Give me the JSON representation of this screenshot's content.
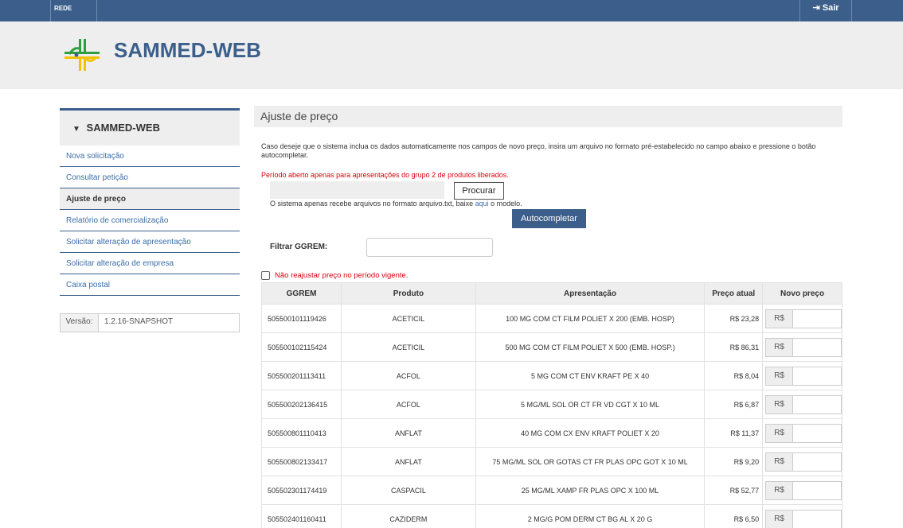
{
  "topbar": {
    "network_label": "REDE INTERNA",
    "logout_label": "Sair"
  },
  "header": {
    "app_title": "SAMMED-WEB"
  },
  "sidebar": {
    "title": "SAMMED-WEB",
    "items": [
      {
        "label": "Nova solicitação"
      },
      {
        "label": "Consultar petição"
      },
      {
        "label": "Ajuste de preço"
      },
      {
        "label": "Relatório de comercialização"
      },
      {
        "label": "Solicitar alteração de apresentação"
      },
      {
        "label": "Solicitar alteração de empresa"
      },
      {
        "label": "Caixa postal"
      }
    ],
    "version_label": "Versão:",
    "version_value": "1.2.16-SNAPSHOT"
  },
  "main": {
    "title": "Ajuste de preço",
    "info_text": "Caso deseje que o sistema inclua os dados automaticamente nos campos de novo preço, insira um arquivo no formato pré-estabelecido no campo abaixo e pressione o botão autocompletar.",
    "warning_text": "Período aberto apenas para apresentações do grupo 2 de produtos liberados.",
    "browse_label": "Procurar",
    "hint_before": "O sistema apenas recebe arquivos no formato arquivo.txt, baixe ",
    "hint_link": "aqui",
    "hint_after": " o modelo.",
    "autocomplete_label": "Autocompletar",
    "filter_label": "Filtrar GGREM:",
    "no_adjust_label": "Não reajustar preço no período vigente."
  },
  "table": {
    "headers": [
      "GGREM",
      "Produto",
      "Apresentação",
      "Preço atual",
      "Novo preço"
    ],
    "currency_prefix": "R$",
    "rows": [
      {
        "ggrem": "505500101119426",
        "produto": "ACETICIL",
        "apresentacao": "100 MG COM CT FILM POLIET X 200 (EMB. HOSP)",
        "preco": "R$ 23,28"
      },
      {
        "ggrem": "505500102115424",
        "produto": "ACETICIL",
        "apresentacao": "500 MG COM CT FILM POLIET X 500 (EMB. HOSP.)",
        "preco": "R$ 86,31"
      },
      {
        "ggrem": "505500201113411",
        "produto": "ACFOL",
        "apresentacao": "5 MG COM CT ENV KRAFT PE X 40",
        "preco": "R$ 8,04"
      },
      {
        "ggrem": "505500202136415",
        "produto": "ACFOL",
        "apresentacao": "5 MG/ML SOL OR CT FR VD CGT X 10 ML",
        "preco": "R$ 6,87"
      },
      {
        "ggrem": "505500801110413",
        "produto": "ANFLAT",
        "apresentacao": "40 MG COM CX ENV KRAFT POLIET X 20",
        "preco": "R$ 11,37"
      },
      {
        "ggrem": "505500802133417",
        "produto": "ANFLAT",
        "apresentacao": "75 MG/ML SOL OR GOTAS CT FR PLAS OPC GOT X 10 ML",
        "preco": "R$ 9,20"
      },
      {
        "ggrem": "505502301174419",
        "produto": "CASPACIL",
        "apresentacao": "25 MG/ML XAMP FR PLAS OPC X 100 ML",
        "preco": "R$ 52,77"
      },
      {
        "ggrem": "505502401160411",
        "produto": "CAZIDERM",
        "apresentacao": "2 MG/G POM DERM CT BG AL X 20 G",
        "preco": "R$ 6,50"
      }
    ]
  }
}
